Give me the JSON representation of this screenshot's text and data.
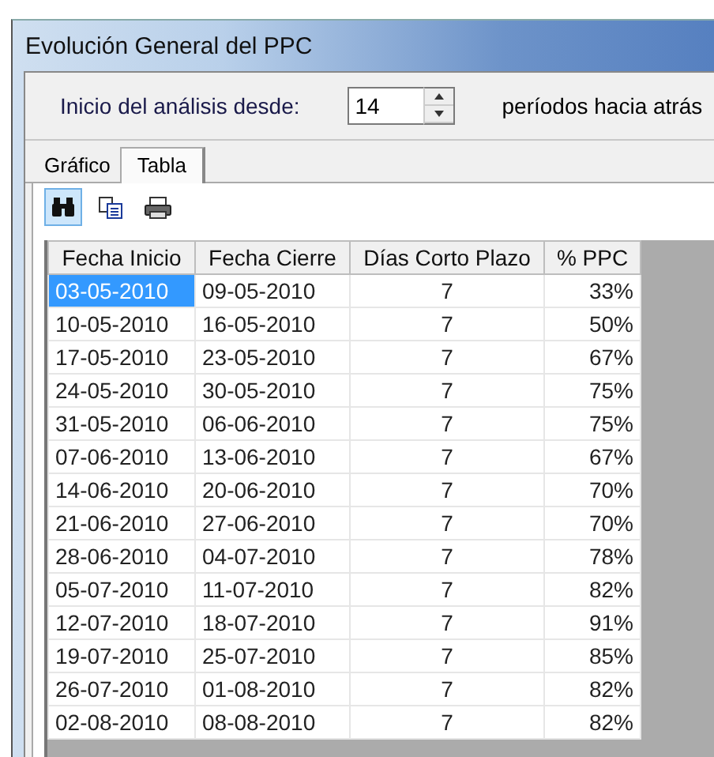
{
  "window": {
    "title": "Evolución General del PPC"
  },
  "range": {
    "label": "Inicio del análisis desde:",
    "value": "14",
    "suffix": "períodos hacia atrás"
  },
  "tabs": [
    {
      "label": "Gráfico",
      "selected": false
    },
    {
      "label": "Tabla",
      "selected": true
    }
  ],
  "toolbar": [
    {
      "kind": "find",
      "selected": true
    },
    {
      "kind": "copy",
      "selected": false
    },
    {
      "kind": "print",
      "selected": false
    }
  ],
  "table": {
    "columns": [
      "Fecha Inicio",
      "Fecha Cierre",
      "Días Corto Plazo",
      "% PPC"
    ],
    "rows": [
      {
        "cells": [
          "03-05-2010",
          "09-05-2010",
          "7",
          "33%"
        ],
        "selected": true
      },
      {
        "cells": [
          "10-05-2010",
          "16-05-2010",
          "7",
          "50%"
        ],
        "selected": false
      },
      {
        "cells": [
          "17-05-2010",
          "23-05-2010",
          "7",
          "67%"
        ],
        "selected": false
      },
      {
        "cells": [
          "24-05-2010",
          "30-05-2010",
          "7",
          "75%"
        ],
        "selected": false
      },
      {
        "cells": [
          "31-05-2010",
          "06-06-2010",
          "7",
          "75%"
        ],
        "selected": false
      },
      {
        "cells": [
          "07-06-2010",
          "13-06-2010",
          "7",
          "67%"
        ],
        "selected": false
      },
      {
        "cells": [
          "14-06-2010",
          "20-06-2010",
          "7",
          "70%"
        ],
        "selected": false
      },
      {
        "cells": [
          "21-06-2010",
          "27-06-2010",
          "7",
          "70%"
        ],
        "selected": false
      },
      {
        "cells": [
          "28-06-2010",
          "04-07-2010",
          "7",
          "78%"
        ],
        "selected": false
      },
      {
        "cells": [
          "05-07-2010",
          "11-07-2010",
          "7",
          "82%"
        ],
        "selected": false
      },
      {
        "cells": [
          "12-07-2010",
          "18-07-2010",
          "7",
          "91%"
        ],
        "selected": false
      },
      {
        "cells": [
          "19-07-2010",
          "25-07-2010",
          "7",
          "85%"
        ],
        "selected": false
      },
      {
        "cells": [
          "26-07-2010",
          "01-08-2010",
          "7",
          "82%"
        ],
        "selected": false
      },
      {
        "cells": [
          "02-08-2010",
          "08-08-2010",
          "7",
          "82%"
        ],
        "selected": false
      }
    ]
  }
}
